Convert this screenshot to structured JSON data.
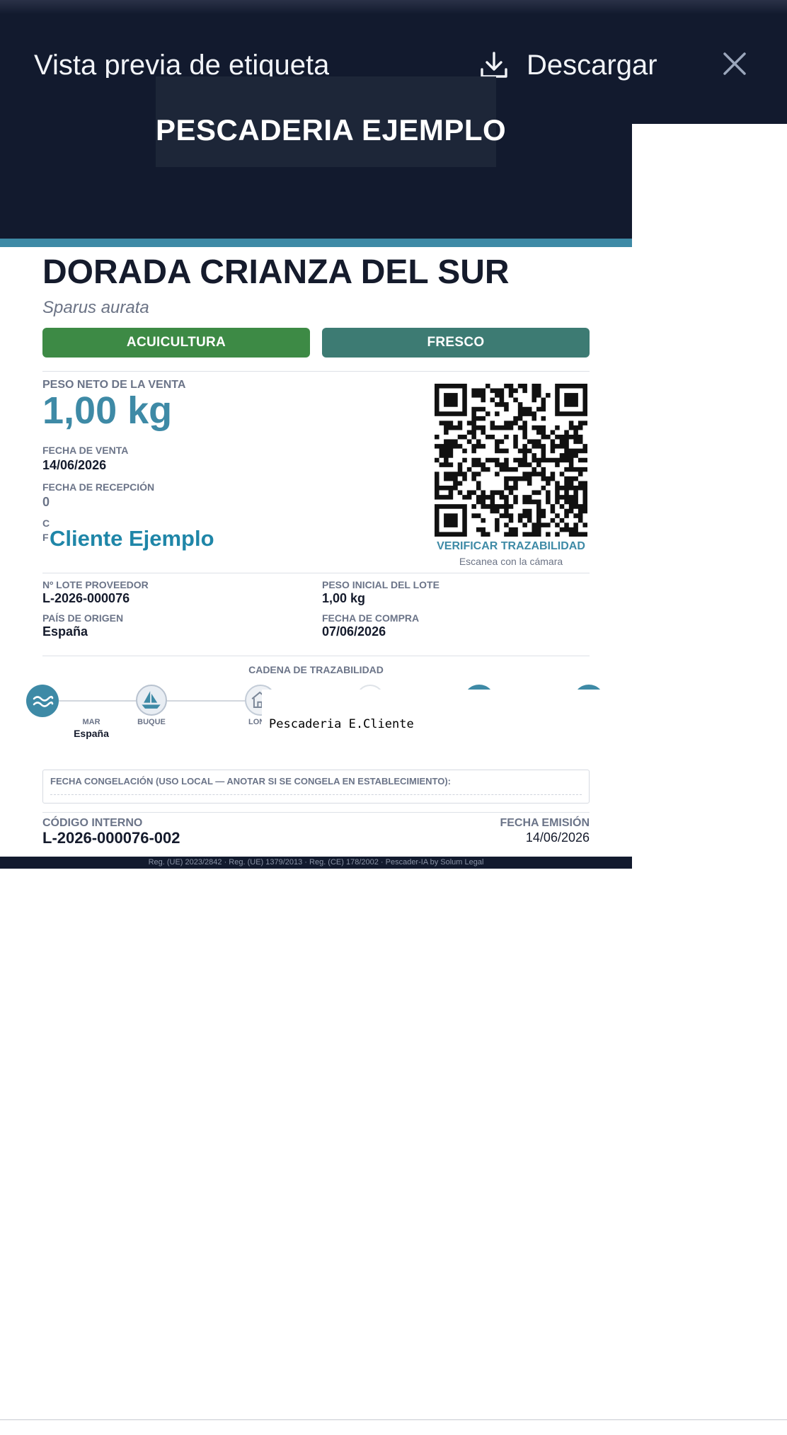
{
  "modal": {
    "title": "Vista previa de etiqueta",
    "download_label": "Descargar",
    "icons": {
      "download": "download-icon",
      "close": "close-icon"
    }
  },
  "label": {
    "store_name": "PESCADERIA EJEMPLO",
    "product_name": "DORADA CRIANZA DEL SUR",
    "scientific_name": "Sparus aurata",
    "badges": {
      "production": "ACUICULTURA",
      "presentation": "FRESCO"
    },
    "net_weight": {
      "label": "PESO NETO DE LA VENTA",
      "value": "1,00 kg"
    },
    "sale_date": {
      "label": "FECHA DE VENTA",
      "value": "14/06/2026"
    },
    "reception_date": {
      "label": "FECHA DE RECEPCIÓN",
      "value": "0"
    },
    "client": {
      "label_initial": "C",
      "label_fragment": "F",
      "value": "Cliente Ejemplo"
    },
    "qr": {
      "verify_label": "VERIFICAR TRAZABILIDAD",
      "hint": "Escanea con la cámara"
    },
    "details": {
      "supplier_lot_label": "Nº LOTE PROVEEDOR",
      "supplier_lot_value": "L-2026-000076",
      "initial_weight_label": "PESO INICIAL DEL LOTE",
      "initial_weight_value": "1,00 kg",
      "origin_label": "PAÍS DE ORIGEN",
      "origin_value": "España",
      "purchase_date_label": "FECHA DE COMPRA",
      "purchase_date_value": "07/06/2026"
    },
    "chain": {
      "title": "CADENA DE TRAZABILIDAD",
      "nodes": [
        {
          "label": "MAR",
          "value": "España",
          "icon": "waves-icon"
        },
        {
          "label": "BUQUE",
          "value": "",
          "icon": "boat-icon"
        },
        {
          "label": "LONJ",
          "value": "",
          "icon": "market-icon"
        }
      ],
      "overlay_text": "Pescaderia E.Cliente"
    },
    "freezing_label": "FECHA CONGELACIÓN (USO LOCAL — ANOTAR SI SE CONGELA EN ESTABLECIMIENTO):",
    "internal_code": {
      "label": "CÓDIGO INTERNO",
      "value": "L-2026-000076-002"
    },
    "issue_date": {
      "label": "FECHA EMISIÓN",
      "value": "14/06/2026"
    },
    "footer": "Reg. (UE) 2023/2842  ·  Reg. (UE) 1379/2013  ·  Reg. (CE) 178/2002  ·  Pescader-IA by Solum Legal"
  },
  "colors": {
    "header_bg": "#121a2e",
    "accent": "#3e8aa6",
    "aquaculture_green": "#3d8a45",
    "fresh_teal": "#3d7b73",
    "client_blue": "#1f86a8"
  }
}
